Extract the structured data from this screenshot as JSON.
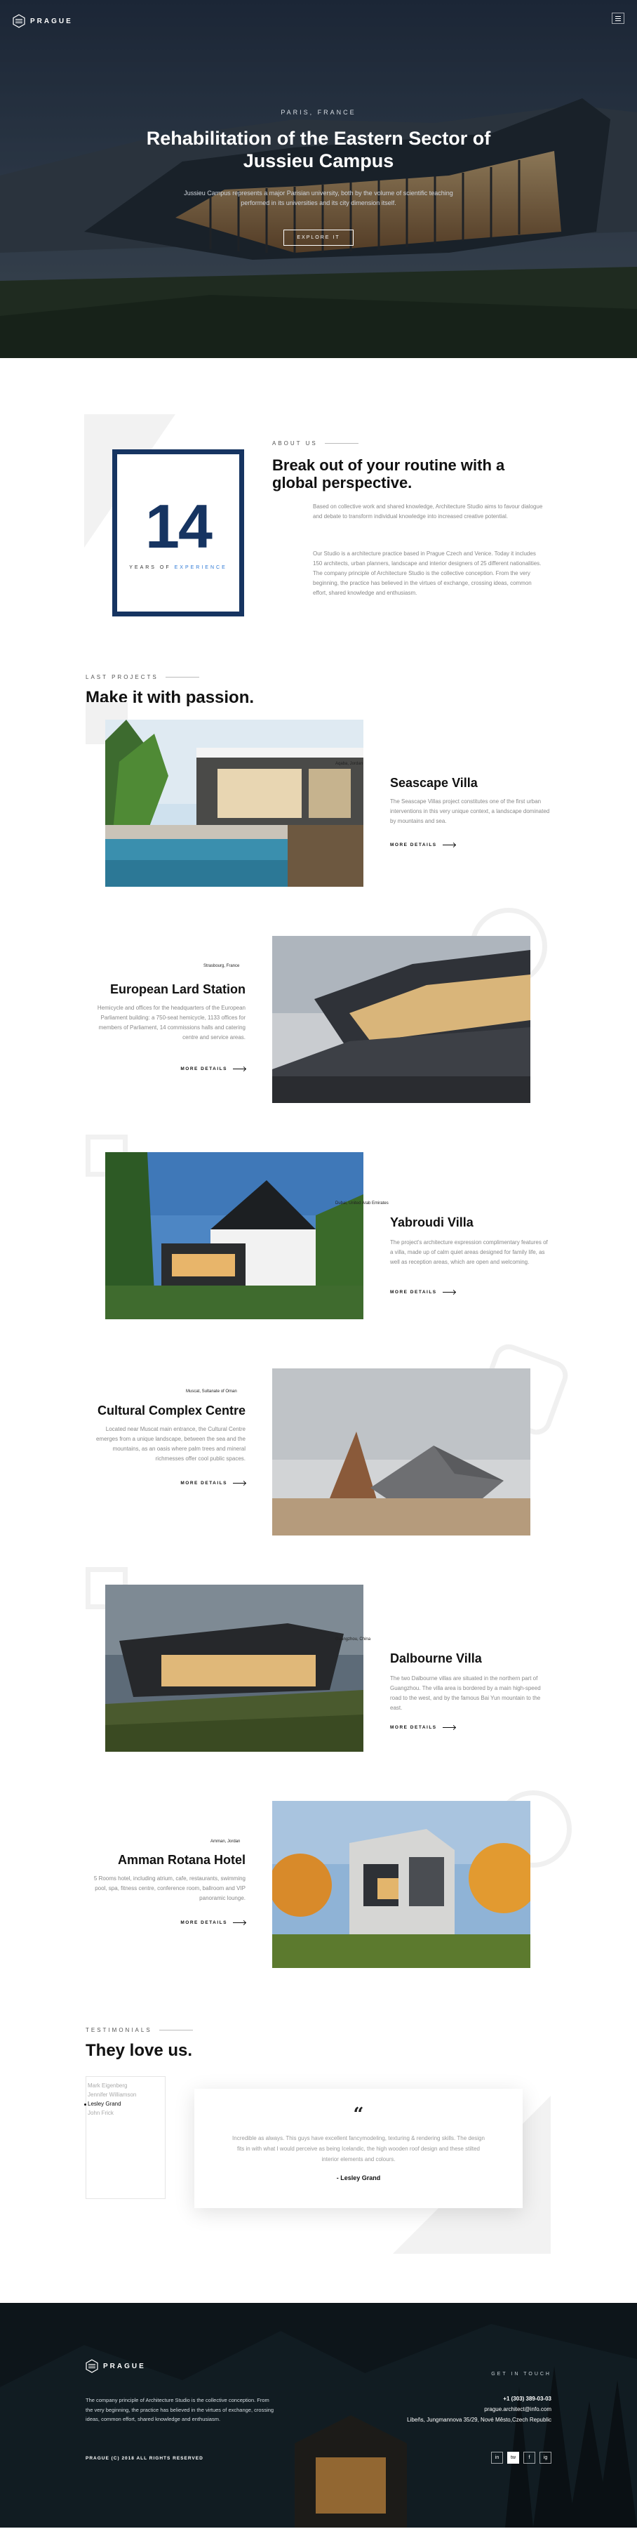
{
  "brand": {
    "name": "PRAGUE"
  },
  "nav": {
    "menu_icon": "hamburger-icon"
  },
  "hero": {
    "kicker": "PARIS, FRANCE",
    "title": "Rehabilitation of the Eastern Sector of Jussieu Campus",
    "text": "Jussieu Campus represents a major Parisian university, both by the volume of scientific teaching performed in its universities and its city dimension itself.",
    "button": "EXPLORE IT"
  },
  "about": {
    "years_number": "14",
    "years_label_a": "YEARS OF",
    "years_label_b": "EXPERIENCE",
    "kicker": "ABOUT US",
    "title": "Break out of your routine with a global perspective.",
    "p1": "Based on collective work and shared knowledge, Architecture Studio aims to favour dialogue and debate to transform individual knowledge into increased creative potential.",
    "p2": "Our Studio is a architecture practice based in Prague Czech and Venice. Today it includes 150 architects, urban planners, landscape and interior designers of 25 different nationalities. The company principle of Architecture Studio is the collective conception. From the very beginning, the practice has believed in the virtues of exchange, crossing ideas, common effort, shared knowledge and enthusiasm."
  },
  "projects": {
    "kicker": "LAST PROJECTS",
    "title": "Make it with passion.",
    "more_label": "MORE DETAILS",
    "items": [
      {
        "location": "Aqaba, Jordan",
        "title": "Seascape Villa",
        "desc": "The Seascape Villas project constitutes one of the first urban interventions in this very unique context, a landscape dominated by mountains and sea."
      },
      {
        "location": "Strasbourg, France",
        "title": "European Lard Station",
        "desc": "Hemicycle and offices for the headquarters of the European Parliament building: a 750-seat hemicycle, 1133 offices for members of Parliament, 14 commissions halls and catering centre and service areas."
      },
      {
        "location": "Dubai, United Arab Emirates",
        "title": "Yabroudi Villa",
        "desc": "The project's architecture expression complimentary features of a villa, made up of calm quiet areas designed for family life, as well as reception areas, which are open and welcoming."
      },
      {
        "location": "Muscat, Sultanate of Oman",
        "title": "Cultural Complex Centre",
        "desc": "Located near Muscat main entrance, the Cultural Centre emerges from a unique landscape, between the sea and the mountains, as an oasis where palm trees and mineral richmesses offer cool public spaces."
      },
      {
        "location": "Guangzhou, China",
        "title": "Dalbourne Villa",
        "desc": "The two Dalbourne villas are situated in the northern part of Guangzhou. The villa area is bordered by a main high-speed road to the west, and by the famous Bai Yun mountain to the east."
      },
      {
        "location": "Amman, Jordan",
        "title": "Amman Rotana Hotel",
        "desc": "5 Rooms hotel, including atrium, cafe, restaurants, swimming pool, spa, fitness centre, conference room, ballroom and VIP panoramic lounge."
      }
    ]
  },
  "testimonials": {
    "kicker": "TESTIMONIALS",
    "title": "They love us.",
    "names": [
      "Mark Eigenberg",
      "Jennifer Williamson",
      "Lesley Grand",
      "John Frick"
    ],
    "active_index": 2,
    "quote": "Incredible as always. This guys have excellent fancymodeling, texturing & rendering skills. The design fits in with what I would perceive as being Icelandic, the high wooden roof design and these stilted interior elements and colours.",
    "author": "- Lesley Grand"
  },
  "footer": {
    "brand": "PRAGUE",
    "about": "The company principle of Architecture Studio is the collective conception. From the very beginning, the practice has believed in the virtues of exchange, crossing ideas, common effort, shared knowledge and enthusiasm.",
    "get_in_touch": "GET IN TOUCH",
    "phone": "+1 (303) 389-03-03",
    "email": "prague.architect@info.com",
    "address": "Libeňs, Jungmannova 35/29, Nové Město,Czech Republic",
    "copyright": "PRAGUE (C) 2018 ALL RIGHTS RESERVED",
    "social": [
      "in",
      "tw",
      "f",
      "ig"
    ],
    "social_icons": [
      "linkedin-icon",
      "twitter-icon",
      "facebook-icon",
      "instagram-icon"
    ]
  }
}
